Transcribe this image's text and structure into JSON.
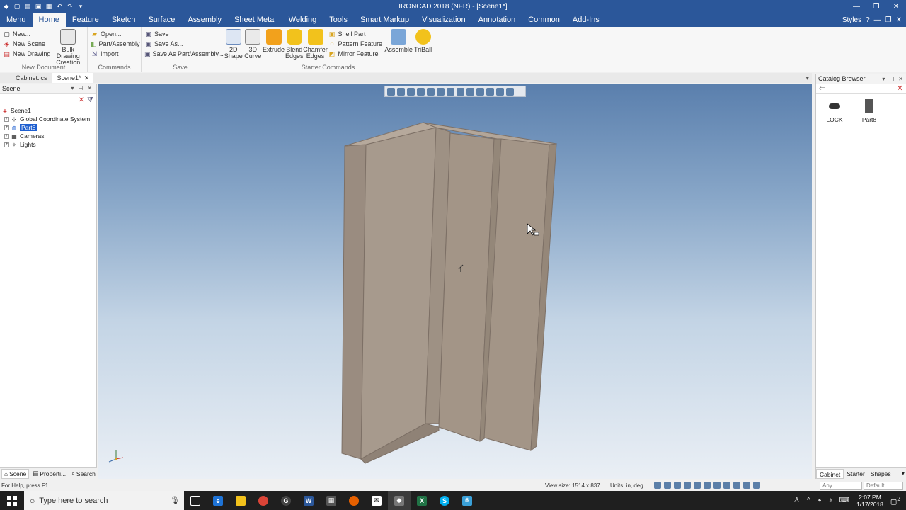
{
  "window": {
    "title": "IRONCAD 2018 (NFR) - [Scene1*]"
  },
  "ribbon_tabs": [
    "Menu",
    "Home",
    "Feature",
    "Sketch",
    "Surface",
    "Assembly",
    "Sheet Metal",
    "Welding",
    "Tools",
    "Smart Markup",
    "Visualization",
    "Annotation",
    "Common",
    "Add-Ins"
  ],
  "active_tab": "Home",
  "styles_label": "Styles",
  "groups": {
    "new_document": {
      "name": "New Document",
      "new": "New...",
      "new_scene": "New Scene",
      "new_drawing": "New Drawing",
      "bulk_line1": "Bulk Drawing",
      "bulk_line2": "Creation"
    },
    "commands": {
      "name": "Commands",
      "open": "Open...",
      "part_assembly": "Part/Assembly",
      "import": "Import"
    },
    "save": {
      "name": "Save",
      "save": "Save",
      "save_as": "Save As...",
      "save_as_part": "Save As Part/Assembly..."
    },
    "starter": {
      "name": "Starter Commands",
      "shape2d_line1": "2D",
      "shape2d_line2": "Shape",
      "curve3d_line1": "3D",
      "curve3d_line2": "Curve",
      "extrude": "Extrude",
      "blend_line1": "Blend",
      "blend_line2": "Edges",
      "chamfer_line1": "Chamfer",
      "chamfer_line2": "Edges",
      "shell_part": "Shell Part",
      "pattern_feature": "Pattern Feature",
      "mirror_feature": "Mirror Feature",
      "assemble": "Assemble",
      "triball": "TriBall"
    }
  },
  "doc_tabs": [
    "Cabinet.ics",
    "Scene1*"
  ],
  "scene_panel": {
    "title": "Scene",
    "tree": [
      "Scene1",
      "Global Coordinate System",
      "Part8",
      "Cameras",
      "Lights"
    ],
    "bottom_tabs": [
      "Scene",
      "Properti...",
      "Search"
    ]
  },
  "catalog": {
    "title": "Catalog Browser",
    "items": [
      "LOCK",
      "Part8"
    ],
    "bottom_tabs": [
      "Cabinet",
      "Starter",
      "Shapes"
    ]
  },
  "status": {
    "help": "For Help, press F1",
    "view_size": "View size: 1514 x 837",
    "units": "Units: in, deg",
    "combo1": "Any",
    "combo2": "Default"
  },
  "taskbar": {
    "search_placeholder": "Type here to search",
    "time": "2:07 PM",
    "date": "1/17/2018",
    "notif_count": "2"
  },
  "colors": {
    "accent": "#2b579a",
    "model_face": "#a39587",
    "selection": "#1e5fd0"
  }
}
